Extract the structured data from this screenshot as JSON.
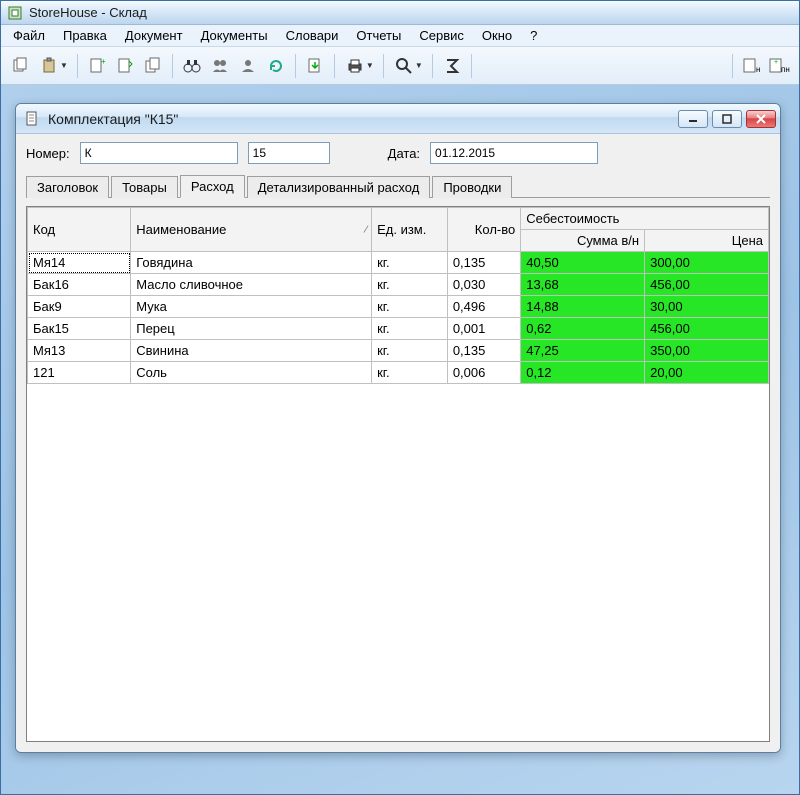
{
  "app": {
    "title": "StoreHouse - Склад"
  },
  "menu": {
    "file": "Файл",
    "edit": "Правка",
    "doc": "Документ",
    "docs": "Документы",
    "dicts": "Словари",
    "reports": "Отчеты",
    "service": "Сервис",
    "window": "Окно",
    "help": "?"
  },
  "child": {
    "title": "Комплектация \"К15\"",
    "labels": {
      "number": "Номер:",
      "date": "Дата:"
    },
    "number_prefix": "К",
    "number_value": "15",
    "date": "01.12.2015"
  },
  "tabs": [
    "Заголовок",
    "Товары",
    "Расход",
    "Детализированный расход",
    "Проводки"
  ],
  "active_tab": 2,
  "columns": {
    "code": "Код",
    "name": "Наименование",
    "unit": "Ед. изм.",
    "qty": "Кол-во",
    "cost_group": "Себестоимость",
    "sum": "Сумма в/н",
    "price": "Цена"
  },
  "rows": [
    {
      "code": "Мя14",
      "name": "Говядина",
      "unit": "кг.",
      "qty": "0,135",
      "sum": "40,50",
      "price": "300,00"
    },
    {
      "code": "Бак16",
      "name": "Масло сливочное",
      "unit": "кг.",
      "qty": "0,030",
      "sum": "13,68",
      "price": "456,00"
    },
    {
      "code": "Бак9",
      "name": "Мука",
      "unit": "кг.",
      "qty": "0,496",
      "sum": "14,88",
      "price": "30,00"
    },
    {
      "code": "Бак15",
      "name": "Перец",
      "unit": "кг.",
      "qty": "0,001",
      "sum": "0,62",
      "price": "456,00"
    },
    {
      "code": "Мя13",
      "name": "Свинина",
      "unit": "кг.",
      "qty": "0,135",
      "sum": "47,25",
      "price": "350,00"
    },
    {
      "code": "121",
      "name": "Соль",
      "unit": "кг.",
      "qty": "0,006",
      "sum": "0,12",
      "price": "20,00"
    }
  ]
}
